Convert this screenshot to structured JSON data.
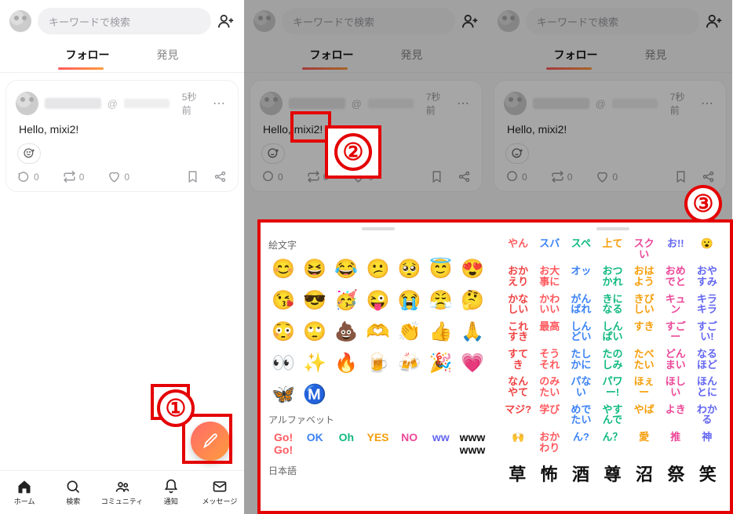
{
  "search": {
    "placeholder": "キーワードで検索"
  },
  "tabs": {
    "follow": "フォロー",
    "discover": "発見"
  },
  "post": {
    "at": "@",
    "time_a": "5秒前",
    "time_b": "7秒前",
    "body": "Hello, mixi2!",
    "comment_n": "0",
    "repost_n": "0",
    "like_n": "0"
  },
  "nav": {
    "home": "ホーム",
    "search": "検索",
    "community": "コミュニティ",
    "notice": "通知",
    "message": "メッセージ"
  },
  "ann": {
    "n1": "①",
    "n2": "②",
    "n3": "③"
  },
  "sheet": {
    "sec_emoji": "絵文字",
    "sec_alpha": "アルファベット",
    "sec_jp": "日本語",
    "emojis": [
      "😊",
      "😆",
      "😂",
      "😕",
      "🥺",
      "😇",
      "😍",
      "😘",
      "😎",
      "🥳",
      "😜",
      "😭",
      "😤",
      "🤔",
      "😳",
      "🙄",
      "💩",
      "🫶",
      "👏",
      "👍",
      "🙏",
      "👀",
      "✨",
      "🔥",
      "🍺",
      "🍻",
      "🎉",
      "💗"
    ],
    "brand": [
      "🦋",
      "Ⓜ️"
    ],
    "alpha": [
      "Go! Go!",
      "OK",
      "Oh",
      "YES",
      "NO",
      "ww",
      "www www"
    ],
    "stickers_top": [
      "やん",
      "スバ",
      "スペ",
      "上て",
      "スクい",
      "お!!",
      "😮"
    ],
    "stickers": [
      [
        "おかえり",
        "お大事に",
        "オッ",
        "おつかれ",
        "おはよう",
        "おめでと",
        "おやすみ"
      ],
      [
        "かなしい",
        "かわいい",
        "がんばれ",
        "きになる",
        "きびしい",
        "キュン",
        "キラキラ"
      ],
      [
        "これすき",
        "最高",
        "しんどい",
        "しんぱい",
        "すき",
        "すごー",
        "すごい!"
      ],
      [
        "すてき",
        "そうそれ",
        "たしかに",
        "たのしみ",
        "たべたい",
        "どんまい",
        "なるほど"
      ],
      [
        "なんやて",
        "のみたい",
        "パない",
        "パワー!",
        "ほぇー",
        "ほしい",
        "ほんとに"
      ],
      [
        "マジ?",
        "学び",
        "めでたい",
        "やすんで",
        "やば",
        "よき",
        "わかる"
      ],
      [
        "🙌",
        "おかわり",
        "ん?",
        "ん？",
        "愛",
        "推",
        "神"
      ]
    ],
    "kanji": [
      "草",
      "怖",
      "酒",
      "尊",
      "沼",
      "祭",
      "笑"
    ]
  }
}
